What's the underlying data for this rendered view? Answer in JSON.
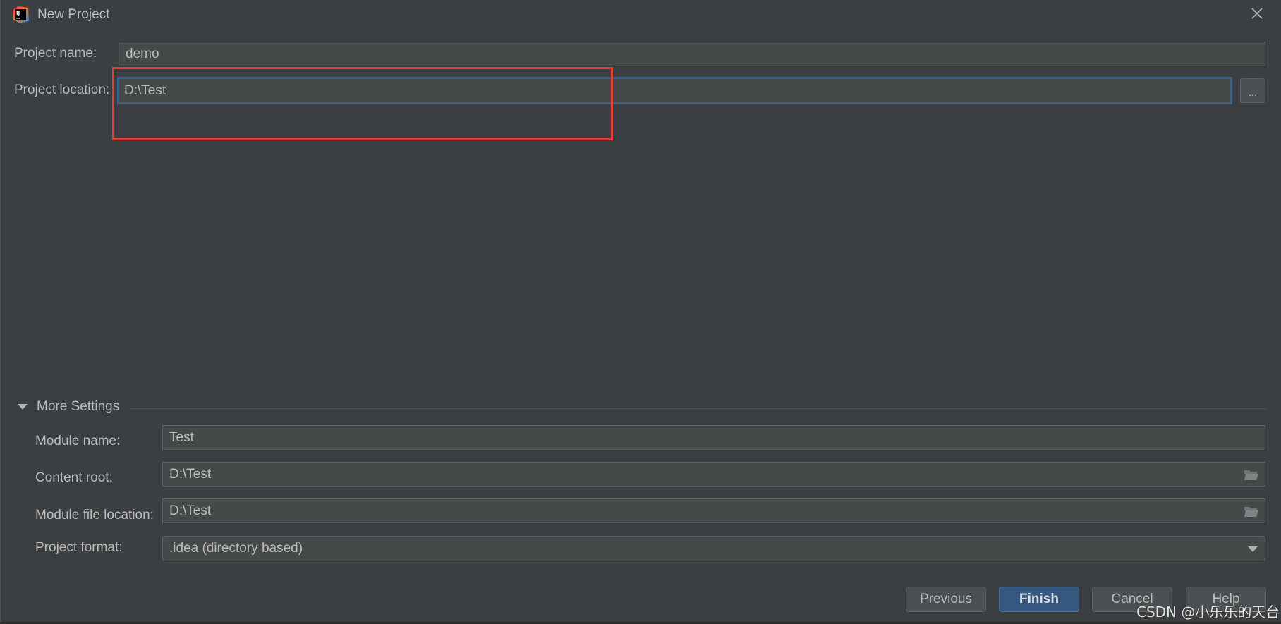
{
  "window": {
    "title": "New Project",
    "app_icon": "intellij-idea-icon",
    "close_icon": "close-icon"
  },
  "form": {
    "project_name": {
      "label": "Project name:",
      "value": "demo"
    },
    "project_location": {
      "label": "Project location:",
      "value": "D:\\Test",
      "browse_label": "..."
    }
  },
  "more_settings": {
    "title": "More Settings",
    "expanded": true,
    "module_name": {
      "label": "Module name:",
      "value": "Test"
    },
    "content_root": {
      "label": "Content root:",
      "value": "D:\\Test",
      "icon": "folder-icon"
    },
    "module_file_location": {
      "label": "Module file location:",
      "value": "D:\\Test",
      "icon": "folder-icon"
    },
    "project_format": {
      "label": "Project format:",
      "value": ".idea (directory based)"
    }
  },
  "buttons": {
    "previous": "Previous",
    "finish": "Finish",
    "cancel": "Cancel",
    "help": "Help"
  },
  "annotation": {
    "color": "#e53935"
  },
  "watermark": "CSDN @小乐乐的天台",
  "colors": {
    "background": "#3c3f41",
    "field": "#45494a",
    "focus_border": "#3d6185",
    "primary_button": "#365880"
  }
}
